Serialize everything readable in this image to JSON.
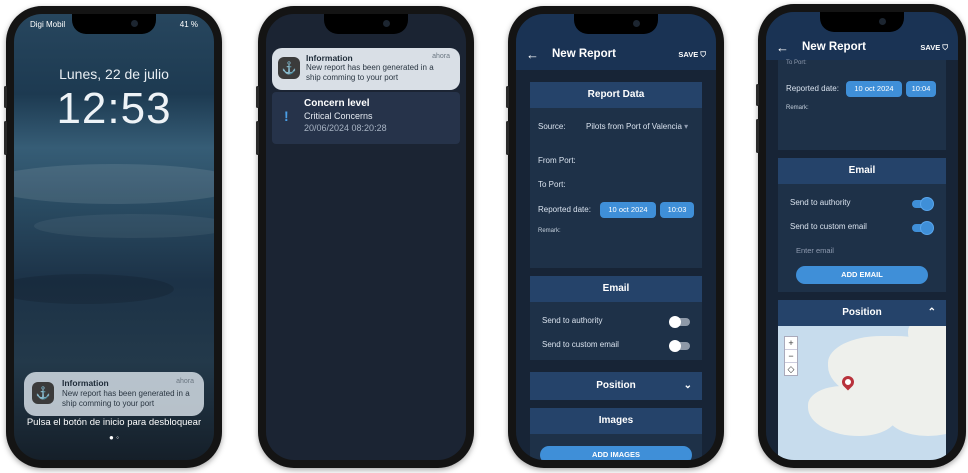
{
  "lockscreen": {
    "carrier": "Digi Mobil",
    "battery": "41 %",
    "date": "Lunes, 22 de julio",
    "time": "12:53",
    "notification": {
      "title": "Information",
      "time": "ahora",
      "body": "New report has been generated in a ship comming to your port"
    },
    "unlock_hint": "Pulsa el botón de inicio para desbloquear"
  },
  "notifications_screen": {
    "info": {
      "title": "Information",
      "time": "ahora",
      "body": "New report has been generated in a ship comming to your port"
    },
    "concern": {
      "title": "Concern level",
      "subtitle": "Critical Concerns",
      "date": "20/06/2024 08:20:28"
    }
  },
  "report_screen": {
    "title": "New Report",
    "save_label": "SAVE",
    "report_data": {
      "heading": "Report Data",
      "source_label": "Source:",
      "source_value": "Pilots from Port of Valencia",
      "from_port_label": "From Port:",
      "to_port_label": "To Port:",
      "reported_date_label": "Reported date:",
      "date_chip": "10 oct 2024",
      "time_chip": "10:03",
      "remark_label": "Remark:"
    },
    "email": {
      "heading": "Email",
      "send_authority_label": "Send to authority",
      "send_custom_label": "Send to custom email",
      "send_authority_on": false,
      "send_custom_on": false
    },
    "position_heading": "Position",
    "images_heading": "Images",
    "add_images_label": "ADD IMAGES"
  },
  "report_screen_2": {
    "title": "New Report",
    "save_label": "SAVE",
    "to_port_label": "To Port:",
    "reported_date_label": "Reported date:",
    "date_chip": "10 oct 2024",
    "time_chip": "10:04",
    "remark_label": "Remark:",
    "email": {
      "heading": "Email",
      "send_authority_label": "Send to authority",
      "send_custom_label": "Send to custom email",
      "send_authority_on": true,
      "send_custom_on": true,
      "email_placeholder": "Enter email",
      "add_email_label": "ADD EMAIL"
    },
    "position_heading": "Position",
    "map_zoom_in": "+",
    "map_zoom_out": "−",
    "map_locate": "◇"
  },
  "colors": {
    "app_bg": "#172436",
    "appbar": "#1a3354",
    "accent": "#3f8fd8",
    "card": "#1e3148"
  }
}
